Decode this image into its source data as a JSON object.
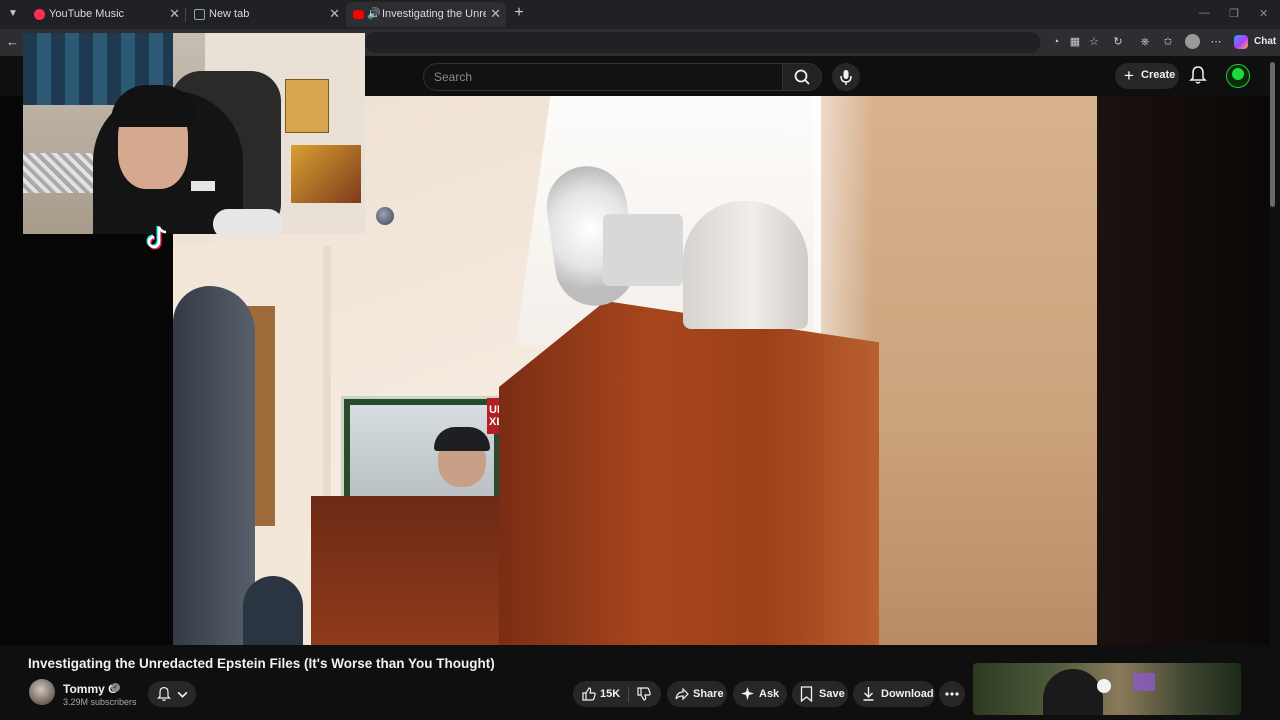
{
  "browser": {
    "tabs": [
      {
        "label": "YouTube Music",
        "favicon_color": "#ff2d55",
        "active": false
      },
      {
        "label": "New tab",
        "favicon_color": "#9aa0a6",
        "active": false
      },
      {
        "label": "Investigating the Unredacted",
        "favicon_color": "#ff0000",
        "active": true,
        "audio_playing": true
      }
    ],
    "address_bar": {
      "url": ""
    },
    "toolbar_icons": [
      "extension-icon",
      "split-screen-icon",
      "favorite-star-icon",
      "refresh-extension-icon",
      "collections-icon",
      "favorites-icon",
      "profile-icon",
      "more-icon"
    ],
    "chat_label": "Chat"
  },
  "youtube": {
    "search": {
      "placeholder": "Search"
    },
    "create_label": "Create",
    "accent": "#ff0000"
  },
  "overlays": {
    "video_frame_sign": {
      "text": "UK\nXL"
    }
  },
  "video": {
    "title": "Investigating the Unredacted Epstein Files (It's Worse than You Thought)",
    "channel": {
      "name": "Tommy G",
      "subscribers": "3.29M subscribers",
      "verified": true
    },
    "actions": {
      "likes": "15K",
      "share": "Share",
      "ask": "Ask",
      "save": "Save",
      "download": "Download"
    }
  }
}
